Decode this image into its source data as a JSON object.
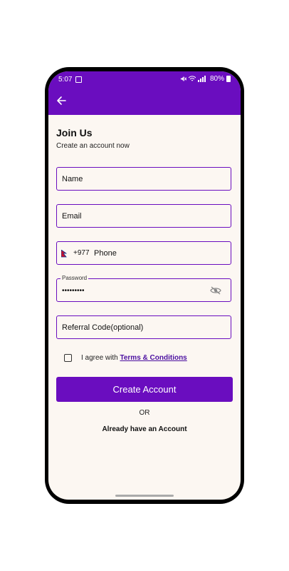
{
  "status_bar": {
    "time": "5:07",
    "battery": "80%"
  },
  "header": {
    "back_icon": "arrow-left-icon"
  },
  "form": {
    "title": "Join Us",
    "subtitle": "Create an account now",
    "name_placeholder": "Name",
    "email_placeholder": "Email",
    "phone_prefix": "+977",
    "phone_placeholder": "Phone",
    "password_label": "Password",
    "password_value": "•••••••••",
    "referral_placeholder": "Referral Code(optional)",
    "agree_text": "I agree with",
    "terms_link": "Terms & Conditions",
    "submit_label": "Create Account",
    "or_text": "OR",
    "login_link": "Already have an Account"
  },
  "colors": {
    "primary": "#6a0dbf",
    "background": "#fcf7f2"
  }
}
